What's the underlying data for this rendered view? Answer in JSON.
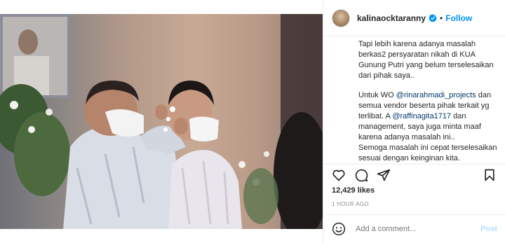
{
  "colors": {
    "accent": "#0095f6",
    "text": "#262626",
    "muted": "#8e8e8e",
    "mention": "#00376b",
    "post_disabled": "#b2dffc"
  },
  "header": {
    "username": "kalinaocktaranny",
    "verified_icon": "verified-badge-icon",
    "separator": "•",
    "follow_label": "Follow"
  },
  "caption": {
    "p1": "Tapi lebih karena adanya masalah berkas2 persyaratan nikah di KUA Gunung Putri yang belum terselesaikan dari pihak saya..",
    "p2_a": "Untuk WO ",
    "p2_m1": "@rinarahmadi_projects",
    "p2_b": " dan semua vendor beserta pihak terkait yg terlibat. A ",
    "p2_m2": "@raffinagita1717",
    "p2_c": " dan management, saya juga minta maaf karena adanya masalah ini..",
    "p3": "Semoga masalah ini cepat terselesaikan sesuai dengan keinginan kita."
  },
  "actions": {
    "like_icon": "heart-icon",
    "comment_icon": "comment-icon",
    "share_icon": "share-icon",
    "save_icon": "bookmark-icon"
  },
  "likes_text": "12,429 likes",
  "timestamp": "1 HOUR AGO",
  "comment_box": {
    "emoji_icon": "emoji-icon",
    "placeholder": "Add a comment...",
    "post_label": "Post"
  },
  "photo": {
    "description_icon": "post-photo"
  }
}
